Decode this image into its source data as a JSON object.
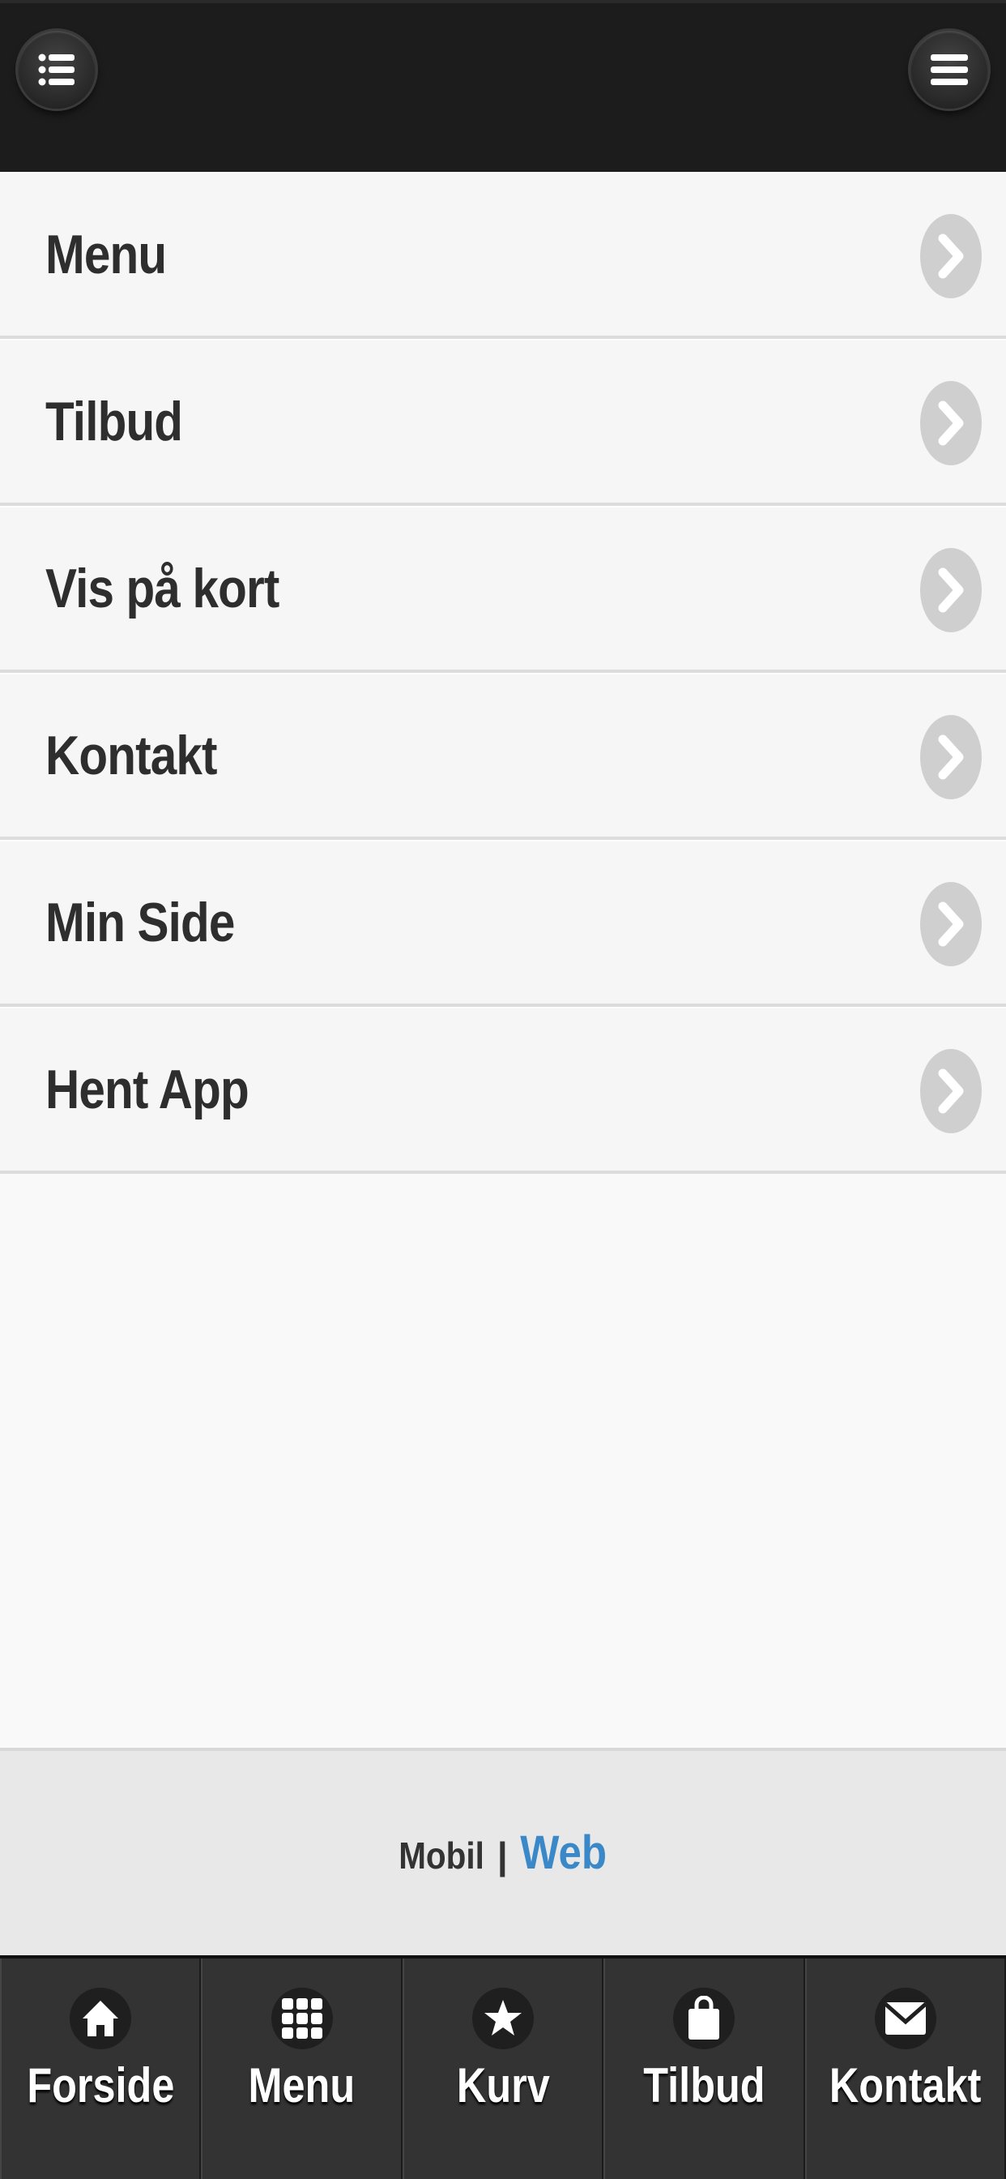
{
  "header": {
    "left_icon": "list-icon",
    "right_icon": "hamburger-menu-icon"
  },
  "menu_items": [
    {
      "label": "Menu",
      "icon": "chevron-right-icon"
    },
    {
      "label": "Tilbud",
      "icon": "chevron-right-icon"
    },
    {
      "label": "Vis på kort",
      "icon": "chevron-right-icon"
    },
    {
      "label": "Kontakt",
      "icon": "chevron-right-icon"
    },
    {
      "label": "Min Side",
      "icon": "chevron-right-icon"
    },
    {
      "label": "Hent App",
      "icon": "chevron-right-icon"
    }
  ],
  "footer": {
    "mobil": "Mobil",
    "separator": "|",
    "web": "Web",
    "web_color": "#3a88c8"
  },
  "tabbar": [
    {
      "label": "Forside",
      "icon": "home-icon"
    },
    {
      "label": "Menu",
      "icon": "grid-icon"
    },
    {
      "label": "Kurv",
      "icon": "star-icon"
    },
    {
      "label": "Tilbud",
      "icon": "shopping-bag-icon"
    },
    {
      "label": "Kontakt",
      "icon": "envelope-icon"
    }
  ],
  "colors": {
    "header_bg": "#1c1c1c",
    "list_bg": "#f6f6f6",
    "footer_bg": "#e8e8e8",
    "tabbar_bg": "#333333"
  }
}
